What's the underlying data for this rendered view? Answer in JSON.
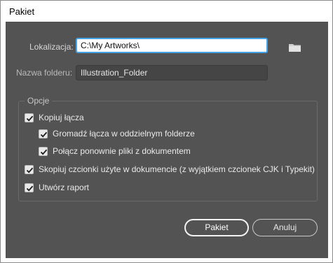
{
  "window": {
    "title": "Pakiet"
  },
  "location": {
    "label": "Lokalizacja:",
    "value": "C:\\My Artworks\\"
  },
  "browse": {
    "icon": "folder-icon"
  },
  "folder_name": {
    "label": "Nazwa folderu:",
    "value": "Illustration_Folder"
  },
  "options": {
    "title": "Opcje",
    "items": [
      {
        "label": "Kopiuj łącza",
        "checked": true
      },
      {
        "label": "Gromadź łącza w oddzielnym folderze",
        "checked": true
      },
      {
        "label": "Połącz ponownie pliki z dokumentem",
        "checked": true
      },
      {
        "label": "Skopiuj czcionki użyte w dokumencie (z wyjątkiem czcionek CJK i Typekit)",
        "checked": true
      },
      {
        "label": "Utwórz raport",
        "checked": true
      }
    ]
  },
  "buttons": {
    "ok": "Pakiet",
    "cancel": "Anuluj"
  },
  "colors": {
    "panel": "#535353",
    "focus": "#45a3e6"
  }
}
